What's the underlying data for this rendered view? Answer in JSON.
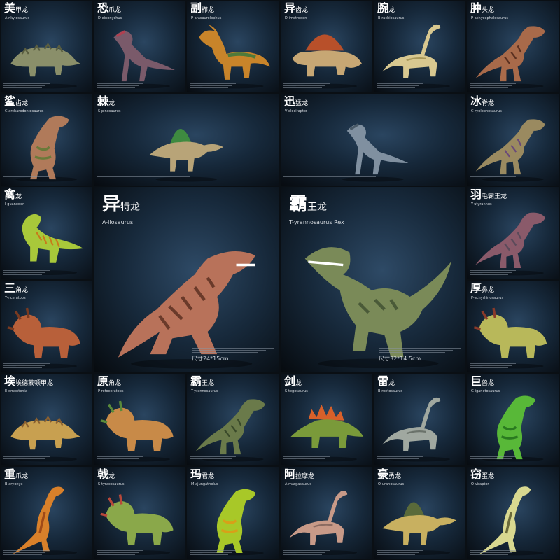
{
  "tiles": [
    {
      "id": "ankylosaurus",
      "c1": "美",
      "c2": "甲龙",
      "sci": "A-nkylosaurus",
      "body": "#8a8f6a",
      "stripe": "#5a5e40",
      "kind": "ankylo"
    },
    {
      "id": "deinonychus",
      "c1": "恐",
      "c2": "爪龙",
      "sci": "D-einonychus",
      "body": "#7a5a6a",
      "stripe": "#b04050",
      "kind": "raptor"
    },
    {
      "id": "parasaurolophus",
      "c1": "副",
      "c2": "栉龙",
      "sci": "P-arasaurolophus",
      "body": "#c8842a",
      "stripe": "#4f7a3a",
      "kind": "hadro"
    },
    {
      "id": "dimetrodon",
      "c1": "异",
      "c2": "齿龙",
      "sci": "D-imetrodon",
      "body": "#c7a774",
      "stripe": "#b8502a",
      "kind": "sail"
    },
    {
      "id": "brachiosaurus",
      "c1": "腕",
      "c2": "龙",
      "sci": "B-rachiosaurus",
      "body": "#d8c890",
      "stripe": "#a8985a",
      "kind": "sauropod"
    },
    {
      "id": "carnotaurus",
      "c1": "肿",
      "c2": "头龙",
      "sci": "P-achycephalosaurus",
      "body": "#a86a4a",
      "stripe": "#5a3020",
      "kind": "theropod"
    },
    {
      "id": "carcharodontosaurus",
      "c1": "鲨",
      "c2": "齿龙",
      "sci": "C-archarodontosaurus",
      "body": "#b07a5a",
      "stripe": "#6a7a3a",
      "kind": "theropodUp"
    },
    {
      "id": "spinosaurus",
      "c1": "棘",
      "c2": "龙",
      "sci": "S-pinosaurus",
      "body": "#b8a478",
      "stripe": "#3e8a40",
      "kind": "spino"
    },
    {
      "id": "velociraptor",
      "c1": "迅",
      "c2": "猛龙",
      "sci": "V-elociraptor",
      "body": "#8090a0",
      "stripe": "#4a5a68",
      "kind": "raptor"
    },
    {
      "id": "cryolophosaurus",
      "c1": "冰",
      "c2": "脊龙",
      "sci": "C-ryolophosaurus",
      "body": "#9a8a60",
      "stripe": "#6a4a7a",
      "kind": "theropod"
    },
    {
      "id": "iguanodon",
      "c1": "禽",
      "c2": "龙",
      "sci": "I-guanodon",
      "body": "#a8c83a",
      "stripe": "#c87a1a",
      "kind": "iguano"
    },
    {
      "id": "allosaurus",
      "c1": "异",
      "c2": "特龙",
      "sci": "A-llosaurus",
      "body": "#b8725a",
      "stripe": "#6a3a2a",
      "kind": "big-allo",
      "big": true,
      "size": "尺寸24*15cm"
    },
    {
      "id": "trex",
      "c1": "霸",
      "c2": "王龙",
      "sci": "T-yrannosaurus Rex",
      "body": "#7a8a58",
      "stripe": "#4a5a38",
      "kind": "big-rex",
      "big": true,
      "size": "尺寸32*14.5cm"
    },
    {
      "id": "yutyrannus",
      "c1": "羽",
      "c2": "毛霸王龙",
      "sci": "Y-utyrannus",
      "body": "#8a5a6a",
      "stripe": "#5a4a5a",
      "kind": "theropod"
    },
    {
      "id": "triceratops",
      "c1": "三",
      "c2": "角龙",
      "sci": "T-riceratops",
      "body": "#b8603a",
      "stripe": "#7a3a20",
      "kind": "cera"
    },
    {
      "id": "pachyrhinosaurus",
      "c1": "厚",
      "c2": "鼻龙",
      "sci": "P-achyrhinosaurus",
      "body": "#b8b85a",
      "stripe": "#8a3a2a",
      "kind": "cera"
    },
    {
      "id": "euoplocephalus",
      "c1": "埃",
      "c2": "埃德蒙顿甲龙",
      "sci": "E-dmontonia",
      "body": "#c8a050",
      "stripe": "#8a6030",
      "kind": "ankylo"
    },
    {
      "id": "protoceratops",
      "c1": "原",
      "c2": "角龙",
      "sci": "P-rotoceratops",
      "body": "#c88a48",
      "stripe": "#5a8a3a",
      "kind": "cera"
    },
    {
      "id": "trex2",
      "c1": "霸",
      "c2": "王龙",
      "sci": "T-yrannosaurus",
      "body": "#6a7a4a",
      "stripe": "#3a4a2a",
      "kind": "theropod"
    },
    {
      "id": "stegosaurus",
      "c1": "剑",
      "c2": "龙",
      "sci": "S-tegosaurus",
      "body": "#7a9a3a",
      "stripe": "#d8602a",
      "kind": "stego"
    },
    {
      "id": "brontosaurus",
      "c1": "雷",
      "c2": "龙",
      "sci": "B-rontosaurus",
      "body": "#a0a8a0",
      "stripe": "#6a726a",
      "kind": "sauropod"
    },
    {
      "id": "giganotosaurus",
      "c1": "巨",
      "c2": "兽龙",
      "sci": "G-iganotosaurus",
      "body": "#58b838",
      "stripe": "#2a7a20",
      "kind": "theropodUp"
    },
    {
      "id": "baryonyx",
      "c1": "重",
      "c2": "爪龙",
      "sci": "B-aryonyx",
      "body": "#d8802a",
      "stripe": "#a04a18",
      "kind": "raptorUp"
    },
    {
      "id": "styracosaurus",
      "c1": "戟",
      "c2": "龙",
      "sci": "S-tyracosaurus",
      "body": "#8aa84a",
      "stripe": "#b8483a",
      "kind": "cera"
    },
    {
      "id": "majungasaurus",
      "c1": "玛",
      "c2": "君龙",
      "sci": "M-ajungatholus",
      "body": "#a8c828",
      "stripe": "#d8a018",
      "kind": "theropodUp"
    },
    {
      "id": "amargasaurus",
      "c1": "阿",
      "c2": "拉摩龙",
      "sci": "A-margasaurus",
      "body": "#c89a88",
      "stripe": "#8a6a60",
      "kind": "sauropod"
    },
    {
      "id": "ouranosaurus",
      "c1": "豪",
      "c2": "勇龙",
      "sci": "O-uranosaurus",
      "body": "#c8b060",
      "stripe": "#5a6a3a",
      "kind": "spino"
    },
    {
      "id": "dilophosaurus",
      "c1": "窃",
      "c2": "蛋龙",
      "sci": "O-viraptor",
      "body": "#d8d890",
      "stripe": "#6a6a3a",
      "kind": "raptorUp"
    }
  ]
}
